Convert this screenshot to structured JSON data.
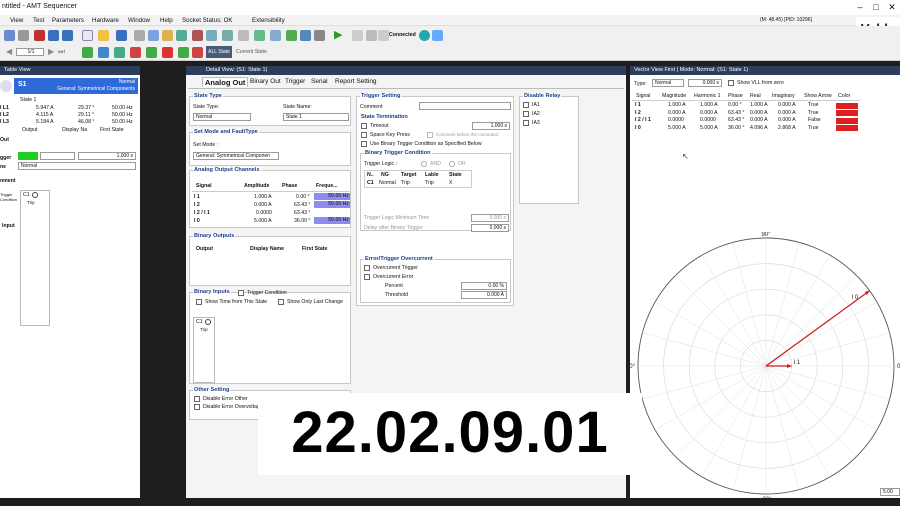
{
  "window": {
    "title": "ntitled - AMT Sequencer",
    "status_right": "(M: 48.45) [PID: 10296]"
  },
  "menu": [
    "View",
    "Test",
    "Parameters",
    "Hardware",
    "Window",
    "Help",
    "Socket Status: OK",
    "Extensibility"
  ],
  "logo": "Vebk",
  "toolbar": {
    "step_value": "1/1",
    "all_state": "ALL State",
    "current_state": "Current State",
    "connected": "Connected"
  },
  "table_view": {
    "title": "Table View",
    "state_name": "S1",
    "mode": "Normal",
    "general": "General: Symmetrical Components",
    "state_label": "State 1",
    "rows": [
      {
        "name": "I L1",
        "mag": "5.947 A",
        "ang": "29.37 °",
        "freq": "50.00 Hz"
      },
      {
        "name": "I L2",
        "mag": "4.115 A",
        "ang": "29.11 °",
        "freq": "50.00 Hz"
      },
      {
        "name": "I L3",
        "mag": "5.184 A",
        "ang": "46.08 °",
        "freq": "50.00 Hz"
      }
    ],
    "out_headers": [
      "Output",
      "Display Na",
      "First State"
    ],
    "side_labels": [
      "Out",
      "gger",
      "ne",
      "nment",
      "Input"
    ],
    "trigger_value": "1.000 s",
    "mode_value": "Normal",
    "binary_label": "Trigger\nCondition",
    "c1_label": "C1",
    "trip_label": "Trip"
  },
  "detail": {
    "title": "Detail View: (S1: State 1)",
    "tabs": [
      "Analog Out",
      "Binary Out",
      "Trigger",
      "Serial",
      "Report Setting"
    ],
    "state_type": {
      "title": "State Type",
      "type_label": "State Type:",
      "type_value": "Normal",
      "name_label": "State Name:",
      "name_value": "State 1"
    },
    "set_mode": {
      "title": "Set Mode and FaultType",
      "mode_label": "Set Mode :",
      "mode_value": "General: Symmetrical Componen"
    },
    "analog": {
      "title": "Analog Output Channels",
      "headers": [
        "Signal",
        "Amplitude",
        "Phase",
        "Freque..."
      ],
      "rows": [
        {
          "signal": "I 1",
          "amp": "1.000 A",
          "phase": "0.00 °",
          "freq": "50.00 Hz"
        },
        {
          "signal": "I 2",
          "amp": "0.000 A",
          "phase": "63.43 °",
          "freq": "50.00 Hz"
        },
        {
          "signal": "I 2 / I 1",
          "amp": "0.0000",
          "phase": "63.43 °",
          "freq": ""
        },
        {
          "signal": "I 0",
          "amp": "5.000 A",
          "phase": "36.00 °",
          "freq": "50.00 Hz"
        }
      ]
    },
    "binary_outputs": {
      "title": "Binary Outputs",
      "headers": [
        "Output",
        "Display Name",
        "First State"
      ]
    },
    "binary_inputs": {
      "title": "Binary Inputs",
      "trigger_condition": "Trigger Condition",
      "show_time": "Show Time from This State",
      "show_last": "Show Only Last Change",
      "c1": "C1",
      "trip": "Trip"
    },
    "other": {
      "title": "Other Setting",
      "disable_other": "Disable Error Other",
      "disable_overvoltage": "Disable Error Overvoltage"
    },
    "trigger_setting": {
      "title": "Trigger Setting",
      "comment_label": "Comment",
      "termination_title": "State Termination",
      "timeout": "Timeout",
      "timeout_value": "1.000 s",
      "space_key": "Space Key Press",
      "comment_before": "Comment before the command",
      "use_binary": "Use Binary Trigger Condition as Specified Below",
      "btc_title": "Binary Trigger Condition",
      "trigger_logic": "Trigger Logic :",
      "and": "AND",
      "or": "OR",
      "btc_headers": [
        "N..",
        "NG",
        "Target",
        "Lable",
        "State"
      ],
      "btc_row": [
        "C1",
        "Normal",
        "Trip",
        "Trip",
        "X"
      ],
      "min_time_label": "Trigger Logic Minimum Time",
      "min_time_value": "0.000 s",
      "delay_label": "Delay after Binary Trigger",
      "delay_value": "0.000 s",
      "err_title": "Error/Trigger Overcurrent",
      "overcurrent_trigger": "Overcurrent Trigger",
      "overcurrent_error": "Overcurrent Error",
      "percent_label": "Percent",
      "percent_value": "0.00 %",
      "threshold_label": "Threshold",
      "threshold_value": "0.000 A"
    },
    "disable_relay": {
      "title": "Disable Relay",
      "items": [
        "IA1",
        "IA2",
        "IA3"
      ]
    }
  },
  "vector": {
    "title": "Vector View First | Mode: Normal: (S1: State 1)",
    "type_label": "Type:",
    "type_value": "Normal",
    "value": "0.000 s",
    "show_vll": "Show VLL from zero",
    "headers": [
      "Signal",
      "Magnitude",
      "Harmonic 1",
      "Phase",
      "Real",
      "Imaginary",
      "Show Arrow",
      "Color"
    ],
    "rows": [
      {
        "signal": "I 1",
        "mag": "1.000 A",
        "harm": "1.000 A",
        "phase": "0.00 °",
        "real": "1.000 A",
        "imag": "0.000 A",
        "arrow": "True",
        "color": "#e02020"
      },
      {
        "signal": "I 2",
        "mag": "0.000 A",
        "harm": "0.000 A",
        "phase": "63.43 °",
        "real": "0.000 A",
        "imag": "0.000 A",
        "arrow": "True",
        "color": "#e02020"
      },
      {
        "signal": "I 2 / I 1",
        "mag": "0.0000",
        "harm": "0.0000",
        "phase": "63.43 °",
        "real": "0.000 A",
        "imag": "0.000 A",
        "arrow": "False",
        "color": "#e02020"
      },
      {
        "signal": "I 0",
        "mag": "5.000 A",
        "harm": "5.000 A",
        "phase": "36.00 °",
        "real": "4.096 A",
        "imag": "2.868 A",
        "arrow": "True",
        "color": "#e02020"
      }
    ],
    "polar": {
      "top": "90°",
      "bottom": "-90°",
      "left": "180°",
      "right": "0°",
      "i1_label": "I 1",
      "i0_label": "I 0",
      "scale": "5.00"
    }
  },
  "overlay_text": "22.02.09.01",
  "colors": {
    "header": "#2d3d5c",
    "accent": "#2a5bd0",
    "freq_fill": "#8c8cf0",
    "vector": "#d01818"
  }
}
